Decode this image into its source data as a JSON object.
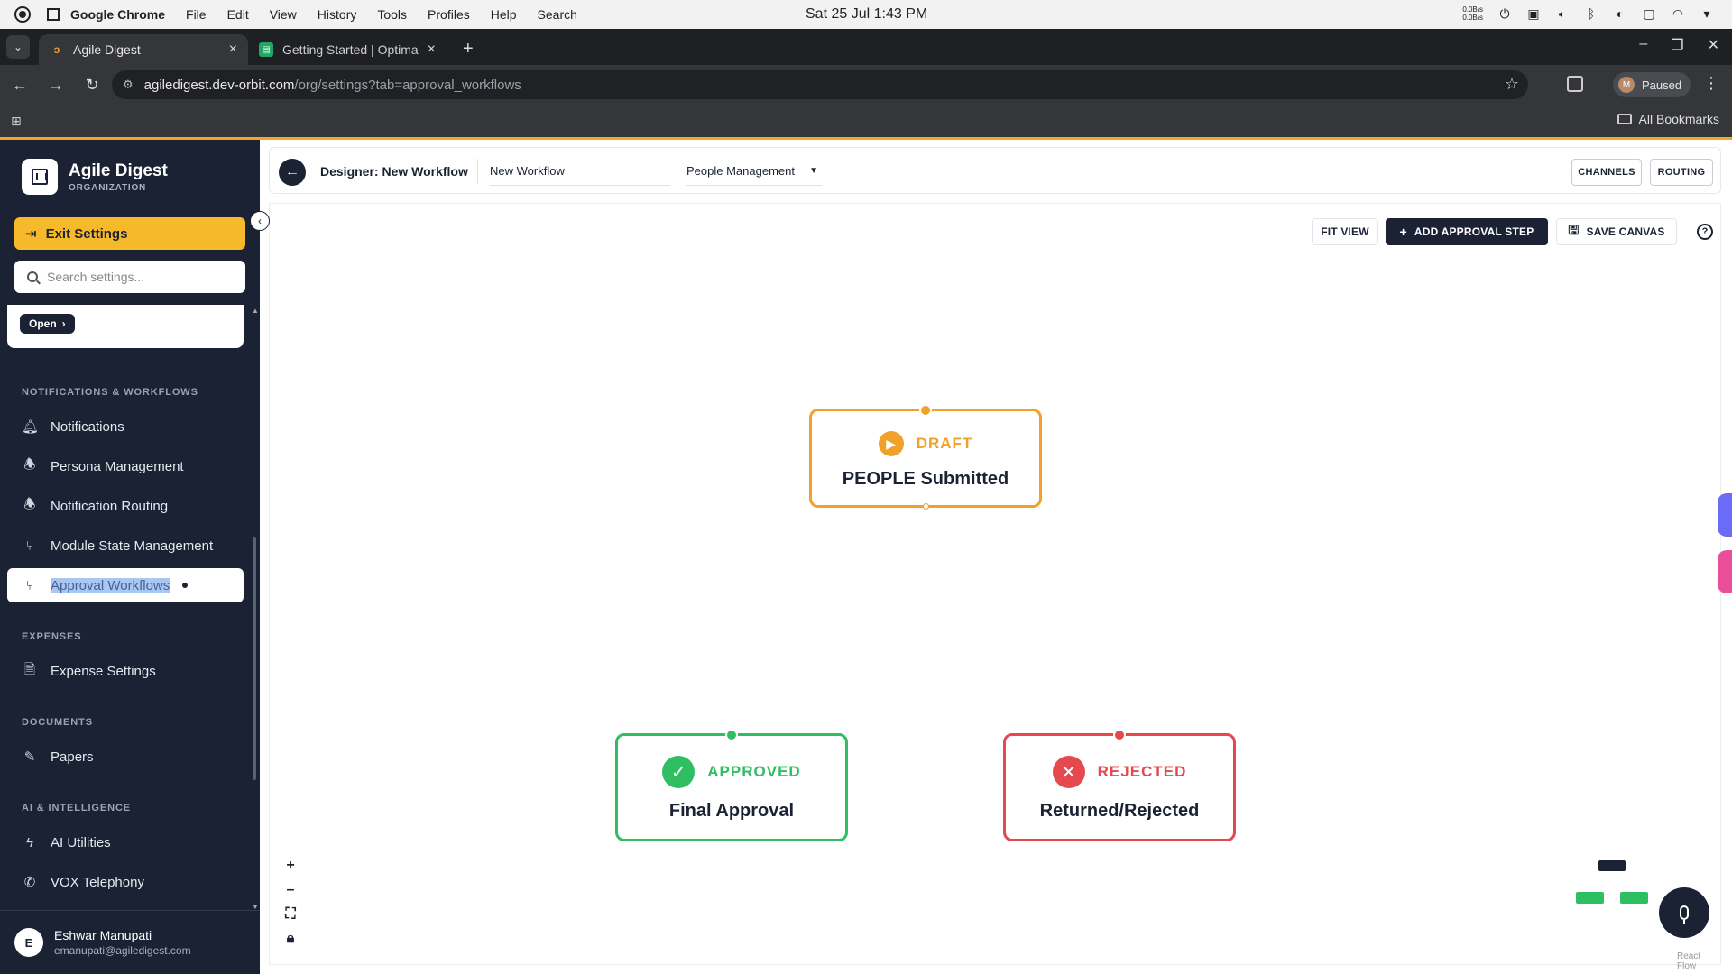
{
  "os": {
    "app_name": "Google Chrome",
    "menu": [
      "File",
      "Edit",
      "View",
      "History",
      "Tools",
      "Profiles",
      "Help",
      "Search"
    ],
    "clock": "Sat 25 Jul  1:43 PM",
    "net_up": "0.0B/s",
    "net_down": "0.0B/s"
  },
  "browser": {
    "tabs": [
      {
        "title": "Agile Digest",
        "active": true
      },
      {
        "title": "Getting Started | Optima C",
        "active": false
      }
    ],
    "url_host": "agiledigest.dev-orbit.com",
    "url_path": "/org/settings?tab=approval_workflows",
    "profile_initial": "M",
    "profile_status": "Paused",
    "all_bookmarks": "All Bookmarks"
  },
  "sidebar": {
    "org_name": "Agile Digest",
    "org_sub": "ORGANIZATION",
    "exit_label": "Exit Settings",
    "search_placeholder": "Search settings...",
    "open_label": "Open",
    "sections": [
      {
        "label": "NOTIFICATIONS & WORKFLOWS",
        "items": [
          {
            "label": "Notifications",
            "icon": "bell-icon"
          },
          {
            "label": "Persona Management",
            "icon": "bell-ring-icon"
          },
          {
            "label": "Notification Routing",
            "icon": "bell-ring-icon"
          },
          {
            "label": "Module State Management",
            "icon": "git-branch-icon"
          },
          {
            "label": "Approval Workflows",
            "icon": "git-branch-icon",
            "active": true
          }
        ]
      },
      {
        "label": "EXPENSES",
        "items": [
          {
            "label": "Expense Settings",
            "icon": "receipt-icon"
          }
        ]
      },
      {
        "label": "DOCUMENTS",
        "items": [
          {
            "label": "Papers",
            "icon": "document-edit-icon"
          }
        ]
      },
      {
        "label": "AI & INTELLIGENCE",
        "items": [
          {
            "label": "AI Utilities",
            "icon": "lightning-icon"
          },
          {
            "label": "VOX Telephony",
            "icon": "phone-icon"
          }
        ]
      }
    ],
    "user": {
      "initial": "E",
      "name": "Eshwar Manupati",
      "email": "emanupati@agiledigest.com"
    }
  },
  "designer": {
    "title": "Designer: New Workflow",
    "workflow_name": "New Workflow",
    "module": "People Management",
    "channels_label": "CHANNELS",
    "routing_label": "ROUTING",
    "fit_view_label": "FIT VIEW",
    "add_step_label": "ADD APPROVAL STEP",
    "save_canvas_label": "SAVE CANVAS",
    "nodes": {
      "draft": {
        "state": "DRAFT",
        "label": "PEOPLE Submitted",
        "color": "#f0a12a"
      },
      "approved": {
        "state": "APPROVED",
        "label": "Final Approval",
        "color": "#2fbf62"
      },
      "rejected": {
        "state": "REJECTED",
        "label": "Returned/Rejected",
        "color": "#e5484d"
      }
    },
    "attribution": "React Flow"
  },
  "colors": {
    "sidebar_bg": "#1a2233",
    "accent": "#f6b92b",
    "primary_dark": "#1a2233"
  }
}
